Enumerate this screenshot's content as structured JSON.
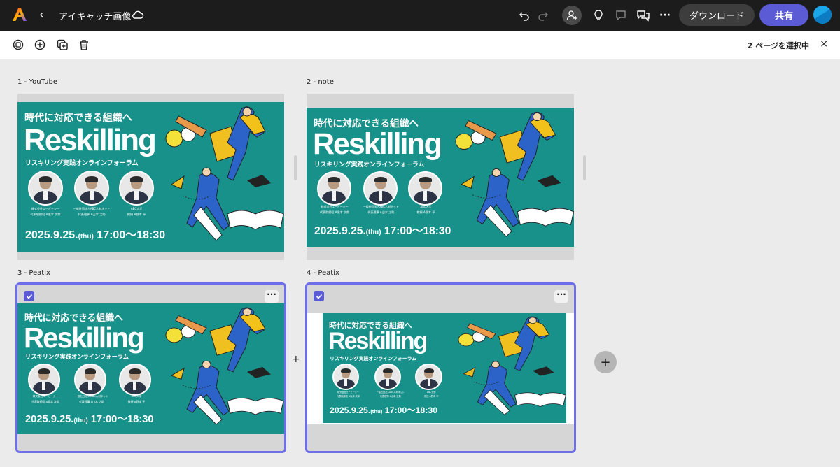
{
  "app": {
    "document_title": "アイキャッチ画像",
    "back_symbol": "‹",
    "download_label": "ダウンロード",
    "share_label": "共有",
    "icons": [
      "undo-icon",
      "redo-icon",
      "invite-icon",
      "lightbulb-icon",
      "comment-icon",
      "feedback-icon",
      "more-icon",
      "cloud-icon"
    ]
  },
  "toolbar": {
    "tools": [
      "duplicate-icon",
      "add-icon",
      "add-page-icon",
      "trash-icon"
    ],
    "selection_status": "2 ページを選択中",
    "close_symbol": "×"
  },
  "pages": [
    {
      "label": "1 - YouTube",
      "selected": false
    },
    {
      "label": "2 - note",
      "selected": false
    },
    {
      "label": "3 - Peatix",
      "selected": true
    },
    {
      "label": "4 - Peatix",
      "selected": true
    }
  ],
  "banner": {
    "subtitle": "時代に対応できる組織へ",
    "title": "Reskilling",
    "tagline": "リスキリング実践オンラインフォーラム",
    "date": "2025.9.25.",
    "weekday": "(thu)",
    "time": "17:00〜18:30",
    "speakers": [
      {
        "org": "株式会社エービーシー",
        "name": "代表取締役 A坂本 次郎"
      },
      {
        "org": "一般社団法人ABC人材ネット",
        "name": "代表理事 A山本 之助"
      },
      {
        "org": "ABC大学",
        "name": "教授 A野本 平"
      }
    ]
  },
  "more_symbol": "···",
  "gap_plus": "+",
  "add_page_symbol": "+",
  "colors": {
    "topbar": "#1c1c1c",
    "accent": "#5b5bd6",
    "selection": "#6e6ee8",
    "banner_bg": "#18918a"
  }
}
